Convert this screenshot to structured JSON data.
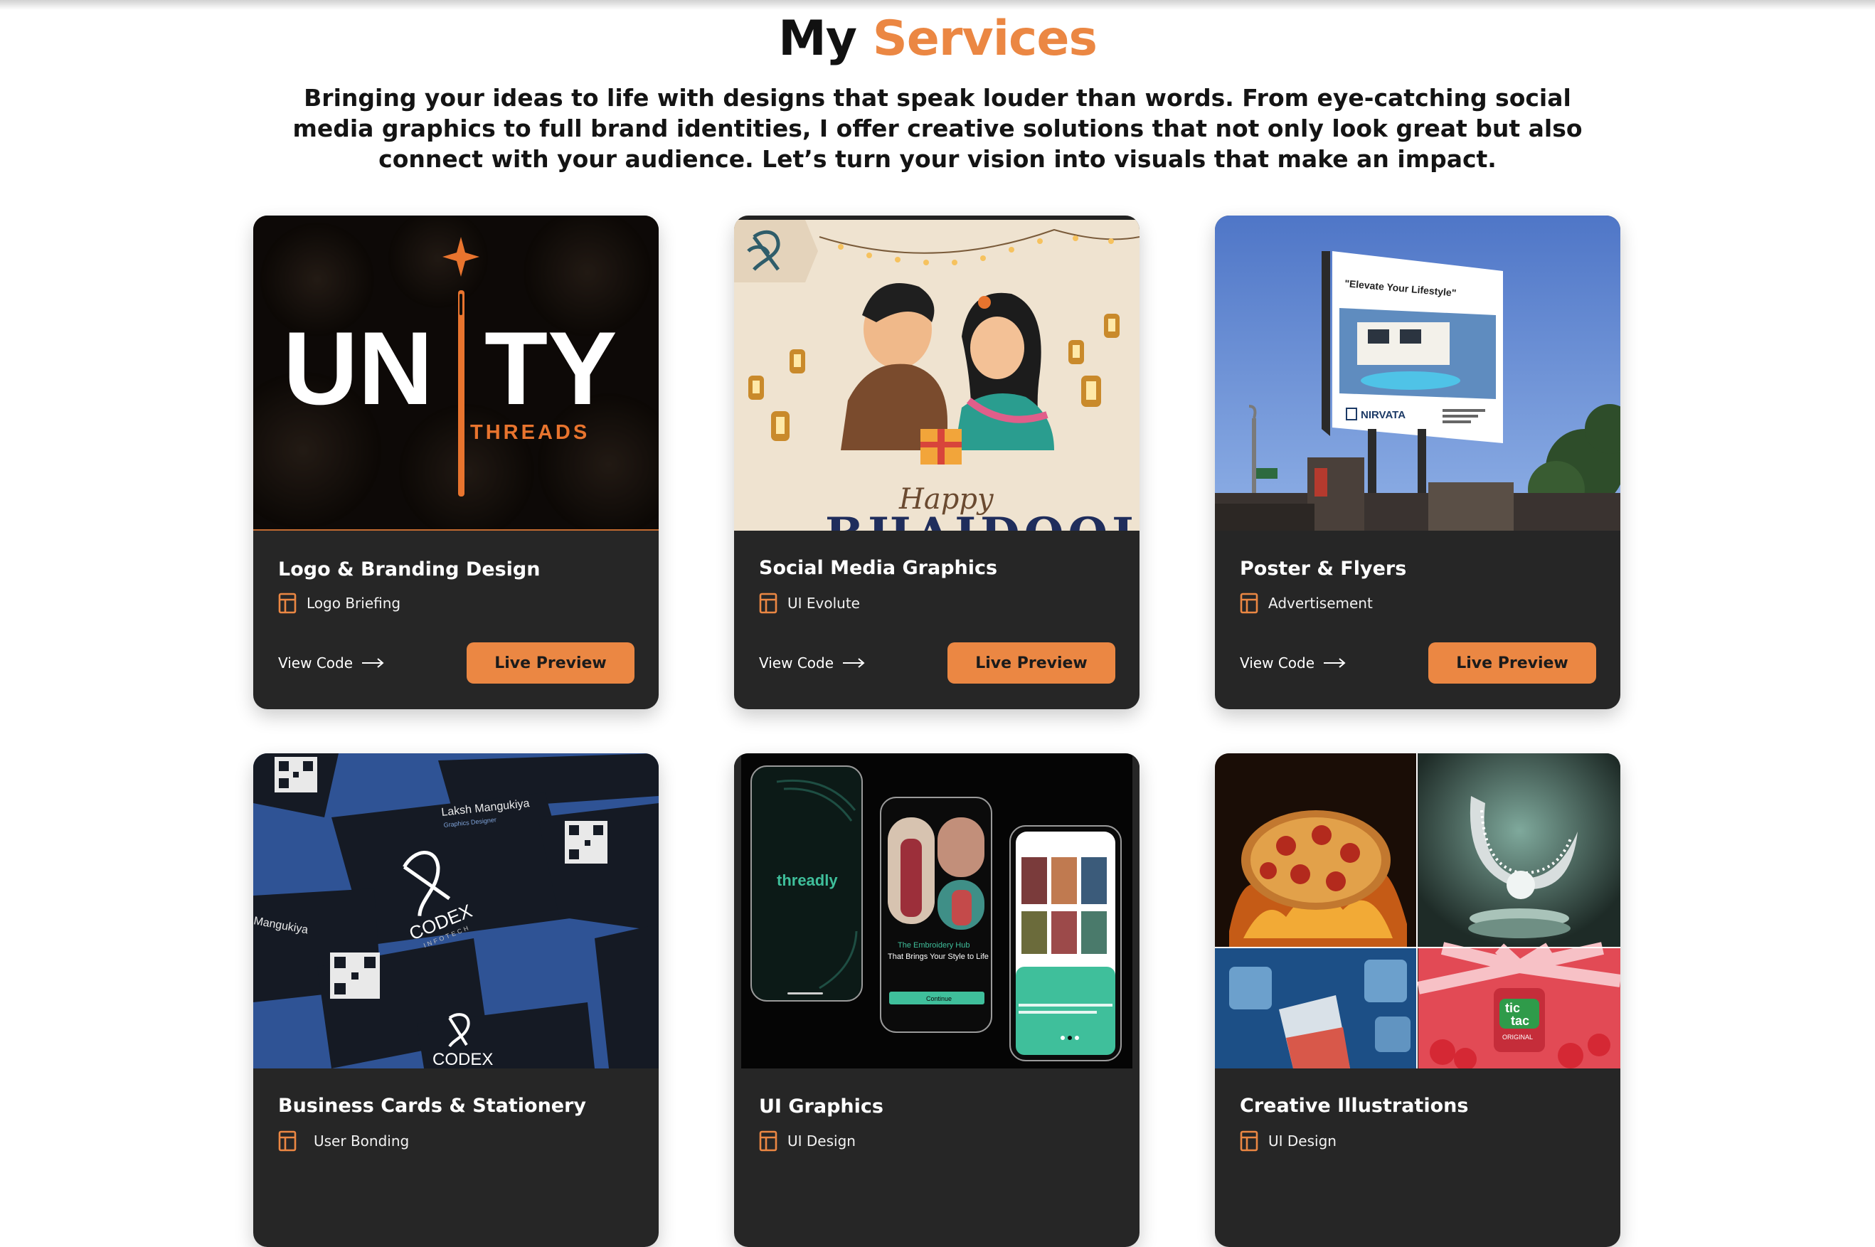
{
  "header": {
    "title_part1": "My",
    "title_part2": "Services",
    "intro": "Bringing your ideas to life with designs that speak louder than words. From eye-catching social media graphics to full brand identities, I offer creative solutions that not only look great but also connect with your audience. Let’s turn your vision into visuals that make an impact."
  },
  "colors": {
    "accent": "#eb8743",
    "card_bg": "#262626"
  },
  "cards": [
    {
      "title": "Logo & Branding Design",
      "tag": "Logo Briefing",
      "view_code": "View Code",
      "live_preview": "Live Preview",
      "image": {
        "brand": "UN",
        "brand_tail": "TY",
        "sub": "THREADS"
      }
    },
    {
      "title": "Social Media Graphics",
      "tag": "UI Evolute",
      "view_code": "View Code",
      "live_preview": "Live Preview",
      "image": {
        "script": "Happy",
        "banner": "BHAIDOOJ"
      }
    },
    {
      "title": "Poster & Flyers",
      "tag": "Advertisement",
      "view_code": "View Code",
      "live_preview": "Live Preview",
      "image": {
        "billboard_headline": "\"Elevate Your Lifestyle\"",
        "billboard_brand": "NIRVATA"
      }
    },
    {
      "title": "Business Cards & Stationery",
      "tag": "User Bonding",
      "image": {
        "name": "Laksh Mangukiya",
        "role": "Graphics Designer",
        "brand": "CODEX",
        "brand_sub": "INFOTECH",
        "partial_name": "Mangukiya"
      }
    },
    {
      "title": "UI Graphics",
      "tag": "UI Design",
      "image": {
        "app_name": "threadly",
        "hub_title": "The Embroidery Hub",
        "hub_sub": "That Brings Your Style to Life",
        "cta": "Continue"
      }
    },
    {
      "title": "Creative Illustrations",
      "tag": "UI Design",
      "image": {
        "candy_brand_1": "tic",
        "candy_brand_2": "tac",
        "candy_sub": "ORIGINAL"
      }
    }
  ]
}
